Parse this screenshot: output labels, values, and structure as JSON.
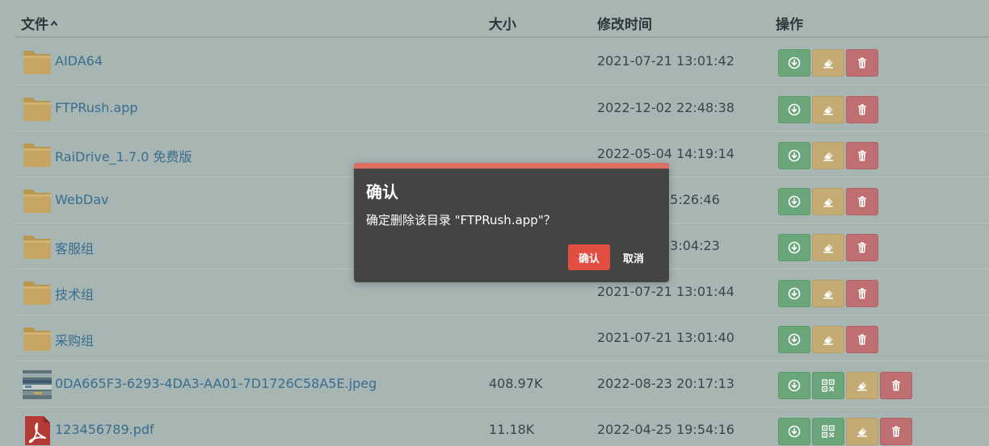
{
  "table": {
    "headers": {
      "name": "文件",
      "size": "大小",
      "modified": "修改时间",
      "actions": "操作"
    },
    "rows": [
      {
        "name": "AIDA64",
        "size": "",
        "modified": "2021-07-21 13:01:42",
        "type": "folder"
      },
      {
        "name": "FTPRush.app",
        "size": "",
        "modified": "2022-12-02 22:48:38",
        "type": "folder"
      },
      {
        "name": "RaiDrive_1.7.0 免费版",
        "size": "",
        "modified": "2022-05-04 14:19:14",
        "type": "folder"
      },
      {
        "name": "WebDav",
        "size": "",
        "modified": "15:26:46",
        "type": "folder"
      },
      {
        "name": "客服组",
        "size": "",
        "modified": "13:04:23",
        "type": "folder"
      },
      {
        "name": "技术组",
        "size": "",
        "modified": "2021-07-21 13:01:44",
        "type": "folder"
      },
      {
        "name": "采购组",
        "size": "",
        "modified": "2021-07-21 13:01:40",
        "type": "folder"
      },
      {
        "name": "0DA665F3-6293-4DA3-AA01-7D1726C58A5E.jpeg",
        "size": "408.97K",
        "modified": "2022-08-23 20:17:13",
        "type": "image"
      },
      {
        "name": "123456789.pdf",
        "size": "11.18K",
        "modified": "2022-04-25 19:54:16",
        "type": "pdf"
      }
    ]
  },
  "dialog": {
    "title": "确认",
    "message": "确定删除该目录 \"FTPRush.app\"？",
    "confirm_label": "确认",
    "cancel_label": "取消"
  },
  "icons": {
    "sort": "chevron-up-icon",
    "folder": "folder-icon",
    "image": "image-thumbnail",
    "pdf": "pdf-icon",
    "download": "download-icon",
    "qrcode": "qrcode-icon",
    "rename": "eraser-icon",
    "delete": "trash-icon"
  },
  "colors": {
    "background": "#a7b5b3",
    "link": "#3a6d8f",
    "download_button": "#6ba57a",
    "rename_button": "#c4ab74",
    "delete_button": "#bf6e71",
    "dialog_bg": "#444444",
    "dialog_accent": "#e06f63",
    "confirm_button": "#e24e42"
  }
}
